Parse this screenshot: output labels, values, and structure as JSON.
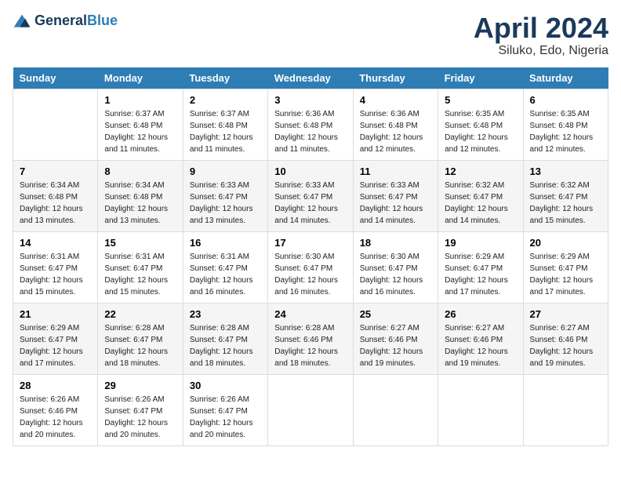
{
  "header": {
    "logo_general": "General",
    "logo_blue": "Blue",
    "month": "April 2024",
    "location": "Siluko, Edo, Nigeria"
  },
  "days_of_week": [
    "Sunday",
    "Monday",
    "Tuesday",
    "Wednesday",
    "Thursday",
    "Friday",
    "Saturday"
  ],
  "weeks": [
    [
      {
        "day": "",
        "sunrise": "",
        "sunset": "",
        "daylight": ""
      },
      {
        "day": "1",
        "sunrise": "Sunrise: 6:37 AM",
        "sunset": "Sunset: 6:48 PM",
        "daylight": "Daylight: 12 hours and 11 minutes."
      },
      {
        "day": "2",
        "sunrise": "Sunrise: 6:37 AM",
        "sunset": "Sunset: 6:48 PM",
        "daylight": "Daylight: 12 hours and 11 minutes."
      },
      {
        "day": "3",
        "sunrise": "Sunrise: 6:36 AM",
        "sunset": "Sunset: 6:48 PM",
        "daylight": "Daylight: 12 hours and 11 minutes."
      },
      {
        "day": "4",
        "sunrise": "Sunrise: 6:36 AM",
        "sunset": "Sunset: 6:48 PM",
        "daylight": "Daylight: 12 hours and 12 minutes."
      },
      {
        "day": "5",
        "sunrise": "Sunrise: 6:35 AM",
        "sunset": "Sunset: 6:48 PM",
        "daylight": "Daylight: 12 hours and 12 minutes."
      },
      {
        "day": "6",
        "sunrise": "Sunrise: 6:35 AM",
        "sunset": "Sunset: 6:48 PM",
        "daylight": "Daylight: 12 hours and 12 minutes."
      }
    ],
    [
      {
        "day": "7",
        "sunrise": "Sunrise: 6:34 AM",
        "sunset": "Sunset: 6:48 PM",
        "daylight": "Daylight: 12 hours and 13 minutes."
      },
      {
        "day": "8",
        "sunrise": "Sunrise: 6:34 AM",
        "sunset": "Sunset: 6:48 PM",
        "daylight": "Daylight: 12 hours and 13 minutes."
      },
      {
        "day": "9",
        "sunrise": "Sunrise: 6:33 AM",
        "sunset": "Sunset: 6:47 PM",
        "daylight": "Daylight: 12 hours and 13 minutes."
      },
      {
        "day": "10",
        "sunrise": "Sunrise: 6:33 AM",
        "sunset": "Sunset: 6:47 PM",
        "daylight": "Daylight: 12 hours and 14 minutes."
      },
      {
        "day": "11",
        "sunrise": "Sunrise: 6:33 AM",
        "sunset": "Sunset: 6:47 PM",
        "daylight": "Daylight: 12 hours and 14 minutes."
      },
      {
        "day": "12",
        "sunrise": "Sunrise: 6:32 AM",
        "sunset": "Sunset: 6:47 PM",
        "daylight": "Daylight: 12 hours and 14 minutes."
      },
      {
        "day": "13",
        "sunrise": "Sunrise: 6:32 AM",
        "sunset": "Sunset: 6:47 PM",
        "daylight": "Daylight: 12 hours and 15 minutes."
      }
    ],
    [
      {
        "day": "14",
        "sunrise": "Sunrise: 6:31 AM",
        "sunset": "Sunset: 6:47 PM",
        "daylight": "Daylight: 12 hours and 15 minutes."
      },
      {
        "day": "15",
        "sunrise": "Sunrise: 6:31 AM",
        "sunset": "Sunset: 6:47 PM",
        "daylight": "Daylight: 12 hours and 15 minutes."
      },
      {
        "day": "16",
        "sunrise": "Sunrise: 6:31 AM",
        "sunset": "Sunset: 6:47 PM",
        "daylight": "Daylight: 12 hours and 16 minutes."
      },
      {
        "day": "17",
        "sunrise": "Sunrise: 6:30 AM",
        "sunset": "Sunset: 6:47 PM",
        "daylight": "Daylight: 12 hours and 16 minutes."
      },
      {
        "day": "18",
        "sunrise": "Sunrise: 6:30 AM",
        "sunset": "Sunset: 6:47 PM",
        "daylight": "Daylight: 12 hours and 16 minutes."
      },
      {
        "day": "19",
        "sunrise": "Sunrise: 6:29 AM",
        "sunset": "Sunset: 6:47 PM",
        "daylight": "Daylight: 12 hours and 17 minutes."
      },
      {
        "day": "20",
        "sunrise": "Sunrise: 6:29 AM",
        "sunset": "Sunset: 6:47 PM",
        "daylight": "Daylight: 12 hours and 17 minutes."
      }
    ],
    [
      {
        "day": "21",
        "sunrise": "Sunrise: 6:29 AM",
        "sunset": "Sunset: 6:47 PM",
        "daylight": "Daylight: 12 hours and 17 minutes."
      },
      {
        "day": "22",
        "sunrise": "Sunrise: 6:28 AM",
        "sunset": "Sunset: 6:47 PM",
        "daylight": "Daylight: 12 hours and 18 minutes."
      },
      {
        "day": "23",
        "sunrise": "Sunrise: 6:28 AM",
        "sunset": "Sunset: 6:47 PM",
        "daylight": "Daylight: 12 hours and 18 minutes."
      },
      {
        "day": "24",
        "sunrise": "Sunrise: 6:28 AM",
        "sunset": "Sunset: 6:46 PM",
        "daylight": "Daylight: 12 hours and 18 minutes."
      },
      {
        "day": "25",
        "sunrise": "Sunrise: 6:27 AM",
        "sunset": "Sunset: 6:46 PM",
        "daylight": "Daylight: 12 hours and 19 minutes."
      },
      {
        "day": "26",
        "sunrise": "Sunrise: 6:27 AM",
        "sunset": "Sunset: 6:46 PM",
        "daylight": "Daylight: 12 hours and 19 minutes."
      },
      {
        "day": "27",
        "sunrise": "Sunrise: 6:27 AM",
        "sunset": "Sunset: 6:46 PM",
        "daylight": "Daylight: 12 hours and 19 minutes."
      }
    ],
    [
      {
        "day": "28",
        "sunrise": "Sunrise: 6:26 AM",
        "sunset": "Sunset: 6:46 PM",
        "daylight": "Daylight: 12 hours and 20 minutes."
      },
      {
        "day": "29",
        "sunrise": "Sunrise: 6:26 AM",
        "sunset": "Sunset: 6:47 PM",
        "daylight": "Daylight: 12 hours and 20 minutes."
      },
      {
        "day": "30",
        "sunrise": "Sunrise: 6:26 AM",
        "sunset": "Sunset: 6:47 PM",
        "daylight": "Daylight: 12 hours and 20 minutes."
      },
      {
        "day": "",
        "sunrise": "",
        "sunset": "",
        "daylight": ""
      },
      {
        "day": "",
        "sunrise": "",
        "sunset": "",
        "daylight": ""
      },
      {
        "day": "",
        "sunrise": "",
        "sunset": "",
        "daylight": ""
      },
      {
        "day": "",
        "sunrise": "",
        "sunset": "",
        "daylight": ""
      }
    ]
  ]
}
